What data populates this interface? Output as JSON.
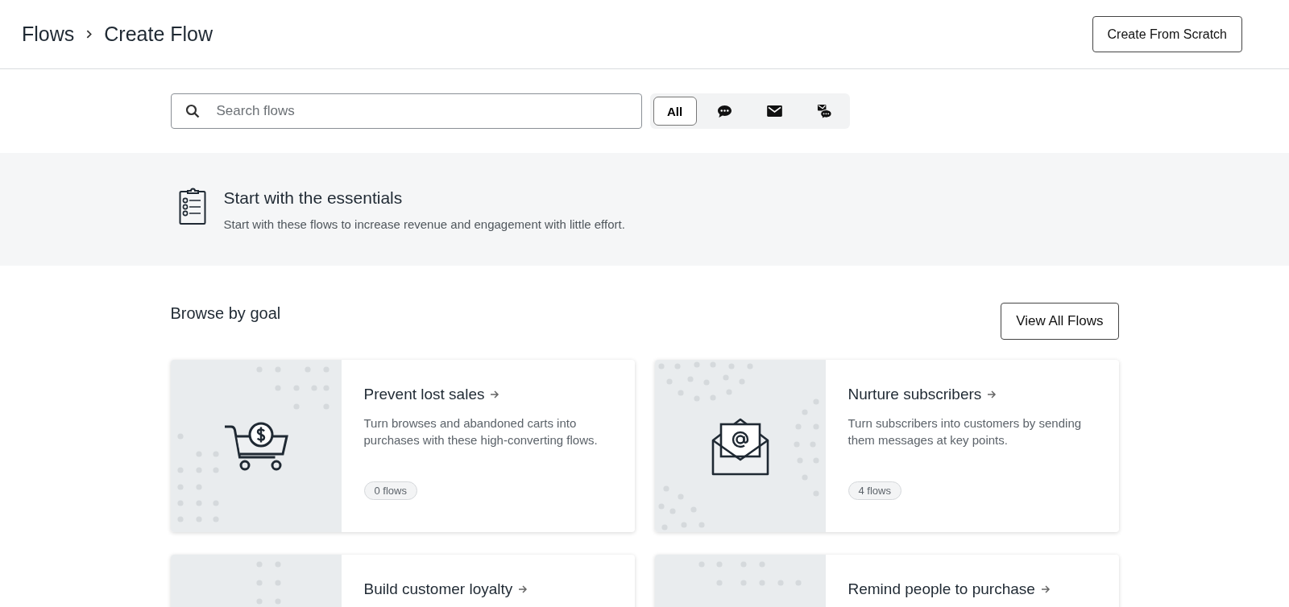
{
  "header": {
    "breadcrumb": [
      "Flows",
      "Create Flow"
    ],
    "button": "Create From Scratch"
  },
  "search": {
    "placeholder": "Search flows"
  },
  "filters": [
    {
      "kind": "text",
      "label": "All",
      "selected": true
    },
    {
      "kind": "sms",
      "selected": false
    },
    {
      "kind": "email",
      "selected": false
    },
    {
      "kind": "both",
      "selected": false
    }
  ],
  "essentials": {
    "title": "Start with the essentials",
    "description": "Start with these flows to increase revenue and engagement with little effort."
  },
  "browse": {
    "title": "Browse by goal",
    "button": "View All Flows"
  },
  "goals": [
    {
      "kind": "cart",
      "title": "Prevent lost sales",
      "description": "Turn browses and abandoned carts into purchases with these high-converting flows.",
      "count": "0 flows"
    },
    {
      "kind": "envelope",
      "title": "Nurture subscribers",
      "description": "Turn subscribers into customers by sending them messages at key points.",
      "count": "4 flows"
    },
    {
      "kind": "unknown",
      "title": "Build customer loyalty"
    },
    {
      "kind": "unknown",
      "title": "Remind people to purchase"
    }
  ]
}
